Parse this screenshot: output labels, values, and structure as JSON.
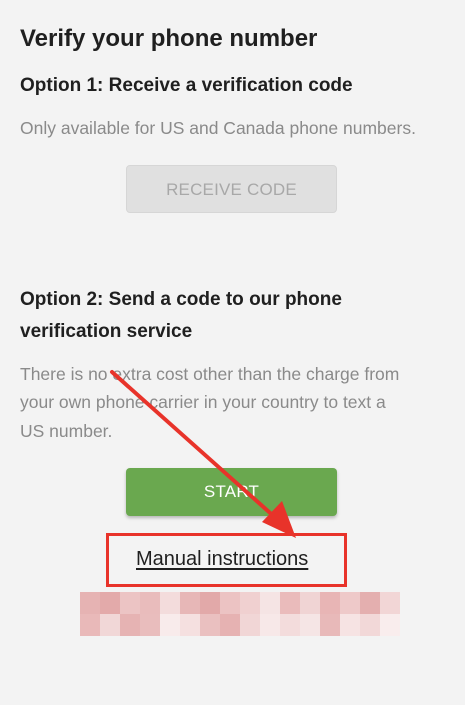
{
  "page": {
    "title": "Verify your phone number"
  },
  "option1": {
    "heading": "Option 1: Receive a verification code",
    "description": "Only available for US and Canada phone numbers.",
    "button_label": "RECEIVE CODE"
  },
  "option2": {
    "heading_line1": "Option 2: Send a code to our phone",
    "heading_line2": "verification service",
    "description_line1": "There is no extra cost other than the charge from",
    "description_line2": "your own phone carrier in your country to text a",
    "description_line3": "US number.",
    "button_label": "START"
  },
  "manual_link": {
    "label": "Manual instructions"
  },
  "colors": {
    "annotation": "#e8332a",
    "primary_button": "#6aa84f",
    "disabled_button": "#e0e0e0"
  },
  "redacted_colors": [
    "#e6b3b3",
    "#e3aaaa",
    "#ecc4c4",
    "#e9bcbc",
    "#f3dcdc",
    "#e7b7b7",
    "#e2a9a9",
    "#ecc3c3",
    "#f0d0d0",
    "#f5e4e4",
    "#eabbbb",
    "#f0d4d4",
    "#e8b5b5",
    "#eec9c9",
    "#e4afaf",
    "#f2d6d6",
    "#e9b9b9",
    "#f1d7d7",
    "#e6b3b3",
    "#e9bdbd",
    "#f8ebeb",
    "#f5e0e0",
    "#eac0c0",
    "#e6b2b2",
    "#f1d6d6",
    "#f7e8e8",
    "#f3dcdc",
    "#f5e5e5",
    "#e8b9b9",
    "#f6e3e3",
    "#f2d8d8",
    "#f9eded"
  ]
}
